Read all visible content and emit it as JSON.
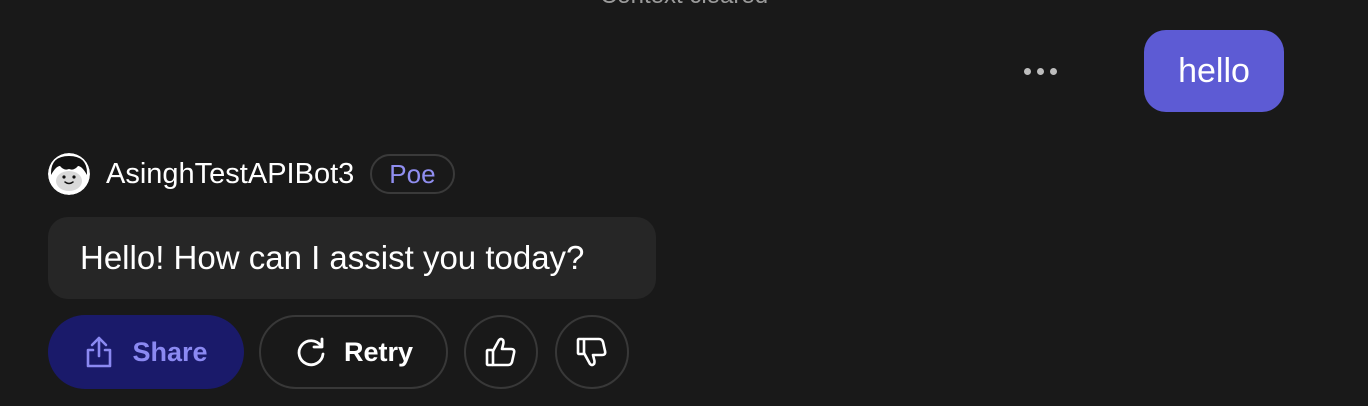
{
  "context_divider": {
    "label": "Context cleared"
  },
  "user_message": {
    "text": "hello",
    "options_icon": "more-horizontal-icon"
  },
  "bot": {
    "name": "AsinghTestAPIBot3",
    "badge": "Poe",
    "avatar_icon": "bot-avatar-icon",
    "reply": "Hello! How can I assist you today?"
  },
  "actions": {
    "share_label": "Share",
    "share_icon": "share-icon",
    "retry_label": "Retry",
    "retry_icon": "retry-icon",
    "like_icon": "thumbs-up-icon",
    "dislike_icon": "thumbs-down-icon"
  },
  "colors": {
    "background": "#191919",
    "user_bubble": "#5d5bd4",
    "bot_bubble": "#262626",
    "share_button_bg": "#1a1a6a",
    "accent_text": "#8b89f2"
  }
}
